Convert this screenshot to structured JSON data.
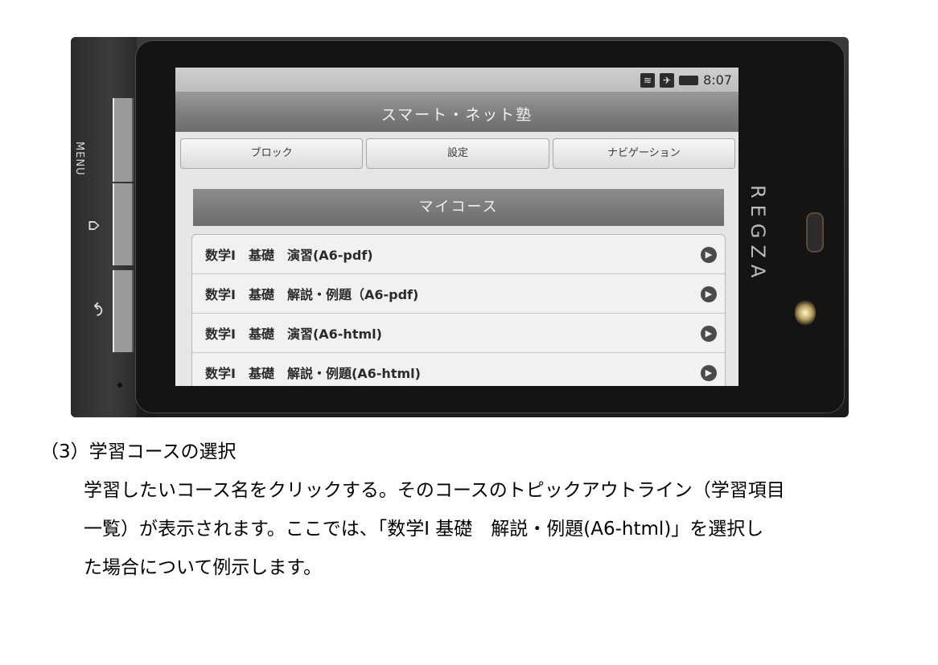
{
  "device": {
    "menu_label": "MENU",
    "brand": "REGZA",
    "home_icon": "home-icon",
    "back_icon": "back-icon"
  },
  "statusbar": {
    "icons": [
      "wifi-icon",
      "airplane-icon",
      "battery-icon"
    ],
    "time": "8:07"
  },
  "app": {
    "title": "スマート・ネット塾"
  },
  "tabs": [
    {
      "label": "ブロック"
    },
    {
      "label": "設定"
    },
    {
      "label": "ナビゲーション"
    }
  ],
  "section": {
    "title": "マイコース"
  },
  "courses": [
    {
      "label": "数学Ⅰ　基礎　演習(A6-pdf)"
    },
    {
      "label": "数学Ⅰ　基礎　解説・例題（A6-pdf)"
    },
    {
      "label": "数学Ⅰ　基礎　演習(A6-html)"
    },
    {
      "label": "数学Ⅰ　基礎　解説・例題(A6-html)"
    }
  ],
  "caption": {
    "heading": "（3）学習コースの選択",
    "lines": [
      "学習したいコース名をクリックする。そのコースのトピックアウトライン（学習項目",
      "一覧）が表示されます。ここでは、「数学Ⅰ 基礎　解説・例題(A6-html)」を選択し",
      "た場合について例示します。"
    ]
  }
}
